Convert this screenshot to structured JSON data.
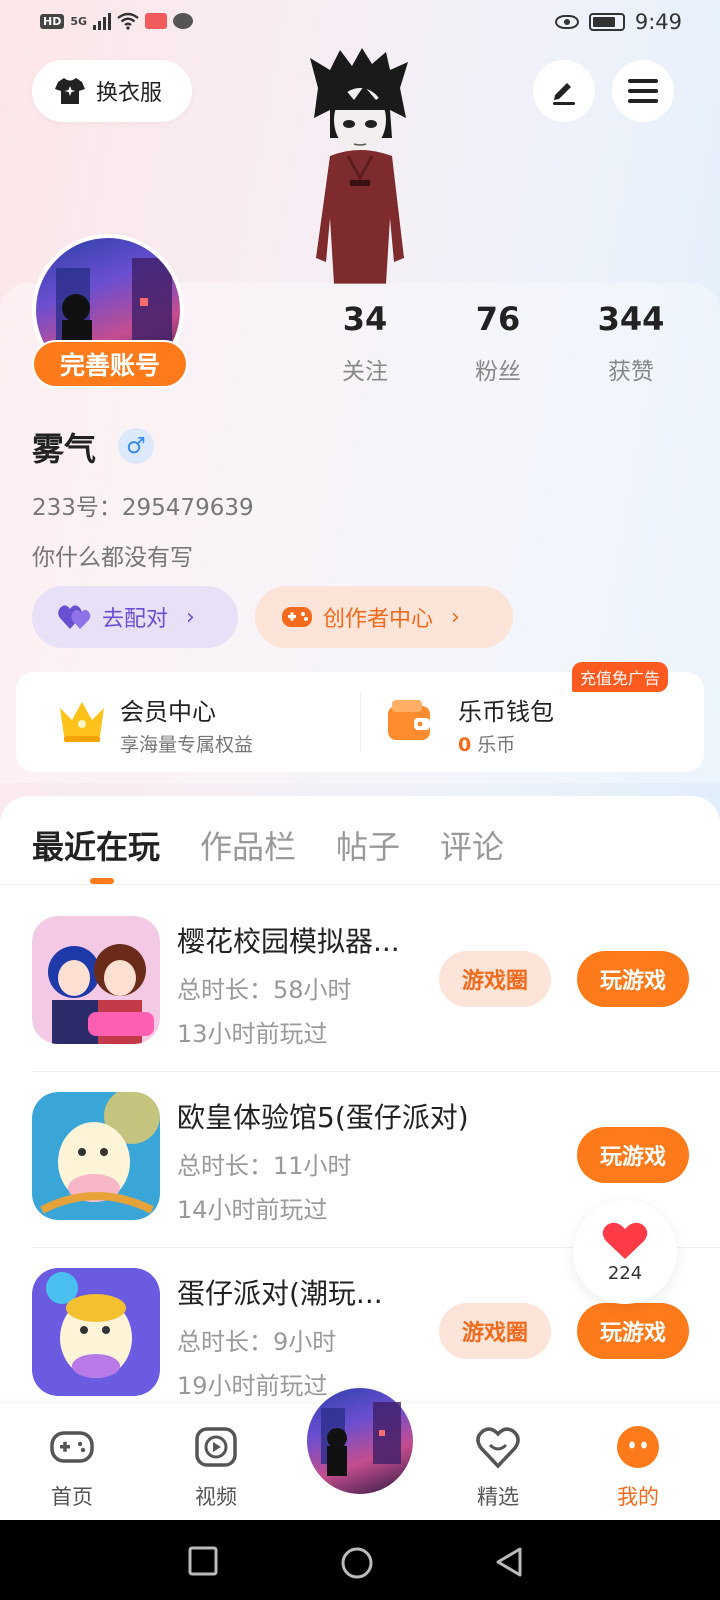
{
  "status_bar": {
    "left_badges": [
      "HD",
      "5G"
    ],
    "time": "9:49"
  },
  "header": {
    "outfit_label": "换衣服",
    "edit_icon": "edit-icon",
    "menu_icon": "menu-icon"
  },
  "profile": {
    "complete_badge": "完善账号",
    "stats": [
      {
        "value": "34",
        "label": "关注"
      },
      {
        "value": "76",
        "label": "粉丝"
      },
      {
        "value": "344",
        "label": "获赞"
      }
    ],
    "username": "雾气",
    "gender_symbol": "♂",
    "uid": "233号：295479639",
    "bio": "你什么都没有写",
    "match_label": "去配对",
    "creator_label": "创作者中心"
  },
  "member": {
    "title": "会员中心",
    "subtitle": "享海量专属权益"
  },
  "wallet": {
    "title": "乐币钱包",
    "coin_value": "0",
    "coin_unit": "乐币",
    "tag": "充值免广告"
  },
  "tabs": [
    {
      "label": "最近在玩",
      "active": true
    },
    {
      "label": "作品栏",
      "active": false
    },
    {
      "label": "帖子",
      "active": false
    },
    {
      "label": "评论",
      "active": false
    }
  ],
  "games": [
    {
      "name": "樱花校园模拟器...",
      "duration": "总时长：58小时",
      "last_played": "13小时前玩过",
      "circle_label": "游戏圈",
      "play_label": "玩游戏"
    },
    {
      "name": "欧皇体验馆5(蛋仔派对)",
      "duration": "总时长：11小时",
      "last_played": "14小时前玩过",
      "circle_label": "",
      "play_label": "玩游戏"
    },
    {
      "name": "蛋仔派对(潮玩...",
      "duration": "总时长：9小时",
      "last_played": "19小时前玩过",
      "circle_label": "游戏圈",
      "play_label": "玩游戏"
    }
  ],
  "like_float": {
    "count": "224"
  },
  "bottom_nav": [
    {
      "label": "首页",
      "icon": "gamepad-icon"
    },
    {
      "label": "视频",
      "icon": "video-icon"
    },
    {
      "label": "精选",
      "icon": "heart-chat-icon"
    },
    {
      "label": "我的",
      "icon": "me-icon"
    }
  ],
  "colors": {
    "accent": "#ff7a1a",
    "accent_text": "#f26b1d",
    "purple": "#6a4fd0"
  }
}
